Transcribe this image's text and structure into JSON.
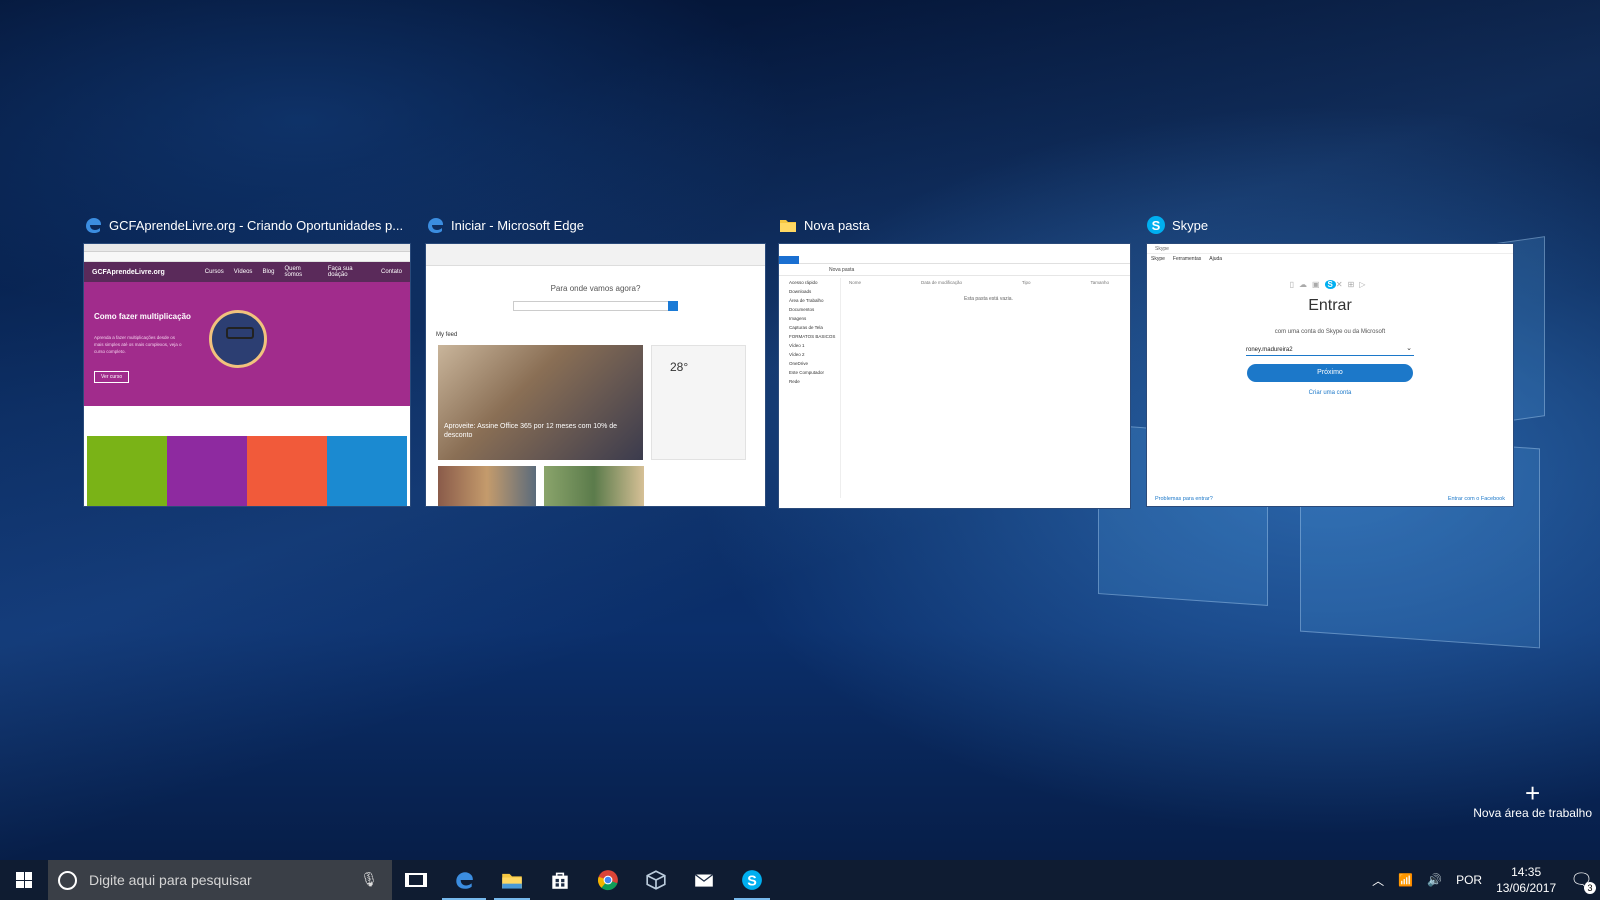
{
  "colors": {
    "accent": "#1c78c9",
    "edge_blue": "#1a7ad6",
    "skype_blue": "#00aff0",
    "gcf_purple": "#a12c8c"
  },
  "windows": [
    {
      "title": "GCFAprendeLivre.org - Criando Oportunidades p...",
      "icon": "edge-icon",
      "thumb": {
        "brand": "GCFAprendeLivre.org",
        "nav": [
          "Cursos",
          "Vídeos",
          "Blog",
          "Quem somos",
          "Faça sua doação",
          "Contato"
        ],
        "hero_title": "Como fazer multiplicação",
        "hero_text": "Aprenda a fazer multiplicações desde os mais simples até os mais complexos, veja o curso completo.",
        "hero_button": "Ver curso",
        "tile_colors": [
          "#7ab317",
          "#8e2aa0",
          "#f15a3a",
          "#1b8ad1"
        ]
      }
    },
    {
      "title": "Iniciar - Microsoft Edge",
      "icon": "edge-icon",
      "thumb": {
        "question": "Para onde vamos agora?",
        "feed_label": "My feed",
        "headline": "Aproveite: Assine Office 365 por 12 meses com 10% de desconto",
        "temperature": "28°"
      }
    },
    {
      "title": "Nova pasta",
      "icon": "folder-icon",
      "thumb": {
        "address": "Nova pasta",
        "columns": [
          "Nome",
          "Data de modificação",
          "Tipo",
          "Tamanho"
        ],
        "empty_text": "Esta pasta está vazia.",
        "nav_items": [
          "Acesso rápido",
          "Downloads",
          "Área de Trabalho",
          "Documentos",
          "Imagens",
          "Capturas de Tela",
          "FORMATOS BASICOS",
          "Vídeo 1",
          "Vídeo 2",
          "OneDrive",
          "Este Computador",
          "Rede"
        ]
      }
    },
    {
      "title": "Skype",
      "icon": "skype-icon",
      "thumb": {
        "window_label": "Skype",
        "menu": [
          "Skype",
          "Ferramentas",
          "Ajuda"
        ],
        "heading": "Entrar",
        "subtitle": "com uma conta do Skype ou da Microsoft",
        "username": "roney.madureira2",
        "next_button": "Próximo",
        "create_link": "Criar uma conta",
        "problems_link": "Problemas para entrar?",
        "facebook_link": "Entrar com o Facebook"
      }
    }
  ],
  "new_desktop": {
    "label": "Nova área de trabalho"
  },
  "taskbar": {
    "search_placeholder": "Digite aqui para pesquisar",
    "apps": [
      "edge-icon",
      "file-explorer-icon",
      "store-icon",
      "chrome-icon",
      "virtualbox-icon",
      "mail-icon",
      "skype-icon"
    ],
    "language": "POR",
    "time": "14:35",
    "date": "13/06/2017",
    "notification_count": "3"
  }
}
